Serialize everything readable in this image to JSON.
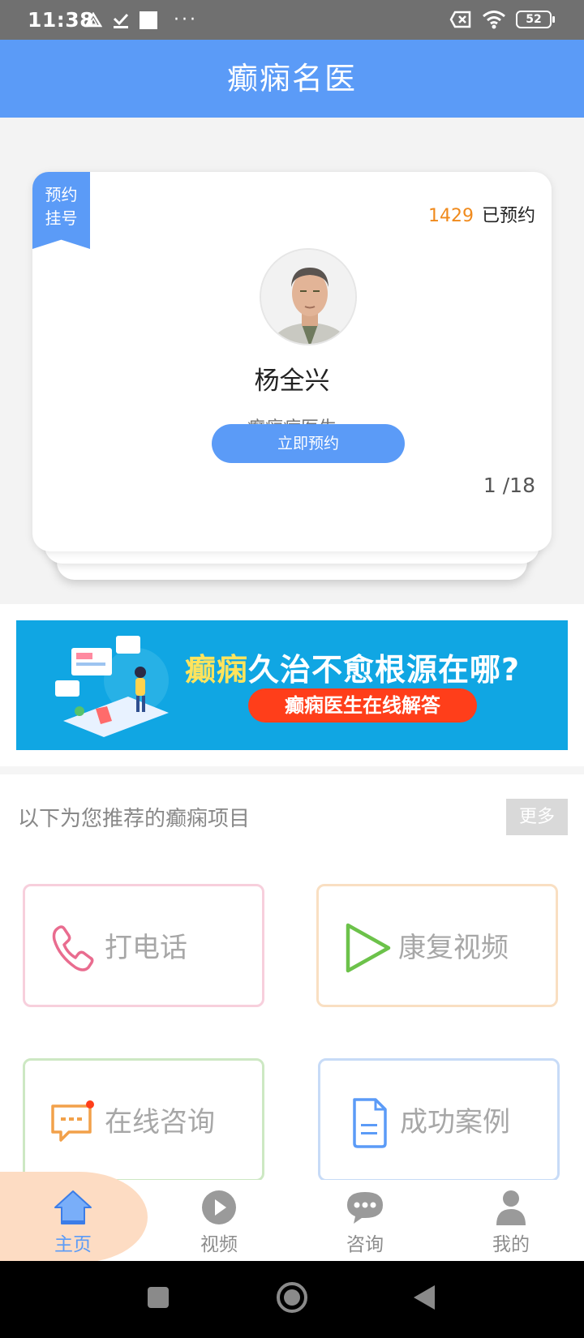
{
  "status_bar": {
    "time": "11:38",
    "battery": "52",
    "icons": [
      "drive-icon",
      "download-done-icon",
      "square-icon",
      "more-dots-icon",
      "sim-off-icon",
      "wifi-icon",
      "battery-icon"
    ]
  },
  "header": {
    "title": "癫痫名医"
  },
  "doctor_card": {
    "ribbon_line1": "预约",
    "ribbon_line2": "挂号",
    "booked_count": "1429",
    "booked_label": "已预约",
    "name": "杨全兴",
    "title": "癫痫病医生",
    "book_button": "立即预约",
    "pager": "1 /18"
  },
  "banner": {
    "title_highlight": "癫痫",
    "title_rest": "久治不愈根源在哪?",
    "subtitle": "癫痫医生在线解答"
  },
  "recommend": {
    "heading": "以下为您推荐的癫痫项目",
    "more": "更多",
    "tiles": [
      {
        "label": "打电话",
        "icon": "phone-icon",
        "color": "#e96c8f"
      },
      {
        "label": "康复视频",
        "icon": "play-icon",
        "color": "#6cc24a"
      },
      {
        "label": "在线咨询",
        "icon": "chat-icon",
        "color": "#f2a14a"
      },
      {
        "label": "成功案例",
        "icon": "document-icon",
        "color": "#5b9bf7"
      }
    ]
  },
  "bottom_nav": {
    "items": [
      {
        "label": "主页",
        "icon": "home-icon",
        "active": true
      },
      {
        "label": "视频",
        "icon": "play-circle-icon"
      },
      {
        "label": "咨询",
        "icon": "chat-bubble-icon"
      },
      {
        "label": "我的",
        "icon": "person-icon"
      }
    ]
  },
  "colors": {
    "brand": "#5b9bf7",
    "accent_orange": "#f08a1c",
    "banner_bg": "#10a6e3",
    "banner_pill": "#ff3e1a"
  }
}
